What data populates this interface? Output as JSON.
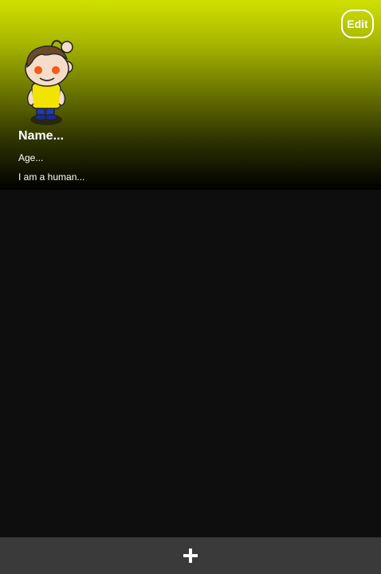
{
  "profile": {
    "edit_label": "Edit",
    "name": "Name...",
    "age": "Age...",
    "bio": "I am a human..."
  },
  "bottom_bar": {
    "add_icon": "plus-icon"
  },
  "colors": {
    "header_gradient_top": "#cfe000",
    "header_gradient_bottom": "#000000",
    "background": "#0e0e0e",
    "bottom_bar": "#3a3a3a",
    "text": "#ffffff"
  }
}
